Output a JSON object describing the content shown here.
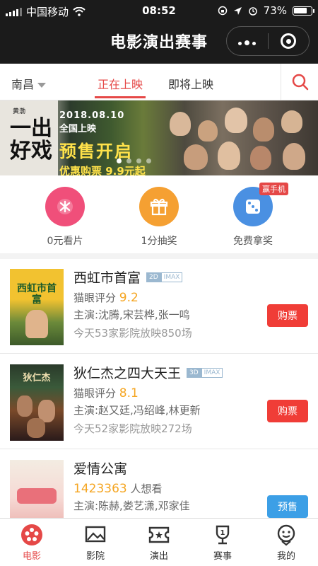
{
  "status_bar": {
    "carrier": "中国移动",
    "time": "08:52",
    "battery": "73%"
  },
  "app_title": "电影演出赛事",
  "nav": {
    "city": "南昌",
    "tabs": [
      {
        "label": "正在上映",
        "active": true
      },
      {
        "label": "即将上映",
        "active": false
      }
    ]
  },
  "banner": {
    "movie_title": "一出好戏",
    "director_label": "黄渤",
    "date": "2018.08.10",
    "release": "全国上映",
    "presale": "预售开启",
    "promo": "优惠购票 9.9元起",
    "slide_count": 4,
    "active_slide": 0
  },
  "quick_actions": [
    {
      "label": "0元看片",
      "icon": "ticket-icon",
      "color": "#f04f7a"
    },
    {
      "label": "1分抽奖",
      "icon": "gift-icon",
      "color": "#f5a032"
    },
    {
      "label": "免费拿奖",
      "icon": "dice-icon",
      "color": "#4a90e2",
      "badge": "赢手机"
    }
  ],
  "movies": [
    {
      "title": "西虹市首富",
      "tags": [
        "2D",
        "IMAX"
      ],
      "rating_label": "猫眼评分",
      "rating": "9.2",
      "cast": "主演:沈腾,宋芸桦,张一鸣",
      "showings": "今天53家影院放映850场",
      "action": "购票",
      "poster_text": "西虹市首富"
    },
    {
      "title": "狄仁杰之四大天王",
      "tags": [
        "3D",
        "IMAX"
      ],
      "rating_label": "猫眼评分",
      "rating": "8.1",
      "cast": "主演:赵又廷,冯绍峰,林更新",
      "showings": "今天52家影院放映272场",
      "action": "购票",
      "poster_text": "狄仁杰"
    },
    {
      "title": "爱情公寓",
      "wish_count": "1423363",
      "wish_label": "人想看",
      "cast": "主演:陈赫,娄艺潇,邓家佳",
      "action": "预售"
    }
  ],
  "tab_bar": [
    {
      "label": "电影",
      "icon": "film-reel-icon",
      "active": true
    },
    {
      "label": "影院",
      "icon": "cinema-icon",
      "active": false
    },
    {
      "label": "演出",
      "icon": "show-ticket-icon",
      "active": false
    },
    {
      "label": "赛事",
      "icon": "trophy-icon",
      "active": false
    },
    {
      "label": "我的",
      "icon": "profile-icon",
      "active": false
    }
  ],
  "colors": {
    "accent": "#e54847",
    "buy_button": "#f03d37",
    "presale_button": "#3c9fe6",
    "rating": "#f5a623"
  }
}
